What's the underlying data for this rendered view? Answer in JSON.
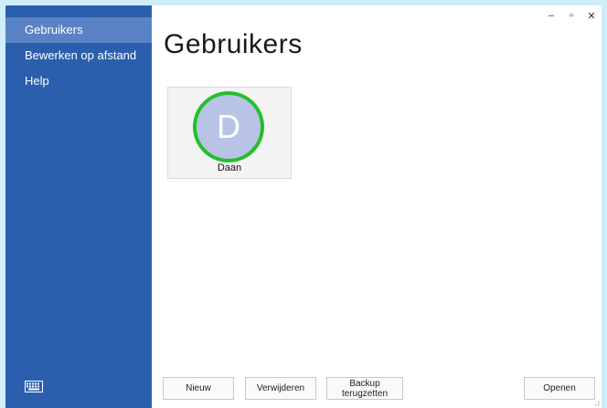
{
  "sidebar": {
    "items": [
      {
        "label": "Gebruikers",
        "active": true
      },
      {
        "label": "Bewerken op afstand",
        "active": false
      },
      {
        "label": "Help",
        "active": false
      }
    ],
    "bottom_icon": "keyboard-icon"
  },
  "window_controls": {
    "minimize": "–",
    "maximize": "▫",
    "close": "✕"
  },
  "main": {
    "title": "Gebruikers",
    "users": [
      {
        "initial": "D",
        "name": "Daan",
        "status_color": "#22c02c"
      }
    ]
  },
  "footer": {
    "new_label": "Nieuw",
    "delete_label": "Verwijderen",
    "restore_label": "Backup terugzetten",
    "open_label": "Openen"
  },
  "colors": {
    "sidebar": "#2b5fad",
    "sidebar_active": "#5b82c4",
    "avatar": "#b8c3e6",
    "status_ring": "#22c02c"
  }
}
